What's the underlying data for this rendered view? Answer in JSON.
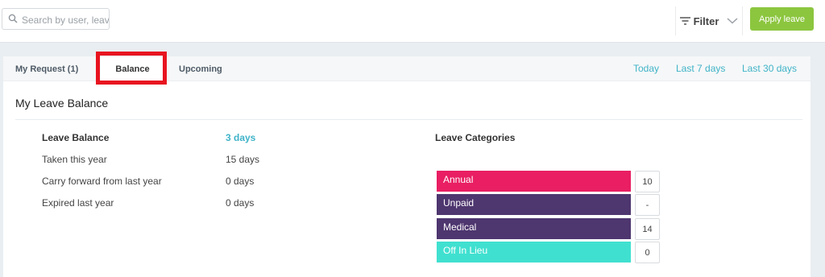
{
  "search": {
    "placeholder": "Search by user, leav"
  },
  "toolbar": {
    "filter_label": "Filter",
    "apply_label": "Apply leave"
  },
  "tabs": [
    {
      "label": "My Request (1)",
      "active": false
    },
    {
      "label": "Balance",
      "active": true
    },
    {
      "label": "Upcoming",
      "active": false
    }
  ],
  "date_ranges": [
    "Today",
    "Last 7 days",
    "Last 30 days"
  ],
  "balance": {
    "title": "My Leave Balance",
    "rows": [
      {
        "label": "Leave Balance",
        "value": "3 days"
      },
      {
        "label": "Taken this year",
        "value": "15 days"
      },
      {
        "label": "Carry forward from last year",
        "value": "0 days"
      },
      {
        "label": "Expired last year",
        "value": "0 days"
      }
    ]
  },
  "categories": {
    "title": "Leave Categories",
    "items": [
      {
        "name": "Annual",
        "count": "10",
        "color": "#e91e63"
      },
      {
        "name": "Unpaid",
        "count": "-",
        "color": "#4e366f"
      },
      {
        "name": "Medical",
        "count": "14",
        "color": "#4e366f"
      },
      {
        "name": "Off In Lieu",
        "count": "0",
        "color": "#40e0d0"
      }
    ]
  },
  "colors": {
    "accent": "#3fb3c8",
    "apply_button": "#8cc63f",
    "highlight": "#e8141f"
  }
}
